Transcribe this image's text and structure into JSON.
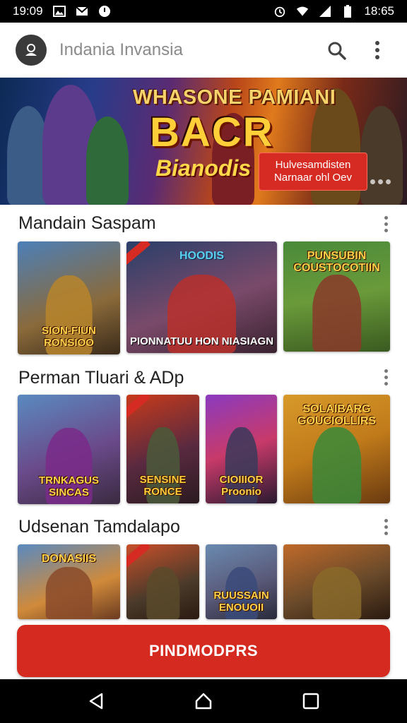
{
  "status_bar": {
    "time_left": "19:09",
    "time_right": "18:65",
    "icons_left": [
      "image-icon",
      "mail-icon",
      "circle-notification-icon"
    ],
    "icons_right": [
      "alarm-icon",
      "wifi-icon",
      "signal-icon",
      "battery-icon"
    ]
  },
  "app_bar": {
    "title": "Indania Invansia",
    "avatar_icon": "user-icon",
    "search_icon": "search-icon",
    "menu_icon": "more-vert-icon"
  },
  "banner": {
    "headline": "WHASONE PAMIANI",
    "big_text": "BACR",
    "sub_text": "Bianodis",
    "cta": "Hulvesamdisten Narnaar ohl Oev"
  },
  "sections": [
    {
      "title": "Mandain Saspam",
      "cards": [
        {
          "caption": "SION-FIUN RONSIOO",
          "caption_pos": "bottom"
        },
        {
          "caption": "HOODIS",
          "caption2": "PIONNATUU HON NIASIAGN",
          "caption_pos": "both"
        },
        {
          "caption": "PUNSUBIN COUSTOCOTIIN",
          "caption_pos": "top"
        }
      ]
    },
    {
      "title": "Perman Tluari & ADp",
      "cards": [
        {
          "caption": "TRNKAGUS SINCAS",
          "caption_pos": "bottom"
        },
        {
          "caption": "SENSINE RONCE",
          "caption_pos": "bottom"
        },
        {
          "caption": "CIOIIIOR Proonio",
          "caption_pos": "bottom"
        },
        {
          "caption": "SOLAIBARG GOUCIOLLIRS",
          "caption_pos": "top"
        }
      ]
    },
    {
      "title": "Udsenan Tamdalapo",
      "cards": [
        {
          "caption": "DONASIIS",
          "caption_pos": "top"
        },
        {
          "caption": "",
          "caption_pos": "none"
        },
        {
          "caption": "RUUSSAIN ENOUOII",
          "caption_pos": "bottom"
        },
        {
          "caption": "",
          "caption_pos": "none"
        }
      ]
    }
  ],
  "install_button": "PINDMODPRS",
  "nav_bar": {
    "back_icon": "back-triangle-icon",
    "home_icon": "home-icon",
    "recents_icon": "recents-square-icon"
  }
}
